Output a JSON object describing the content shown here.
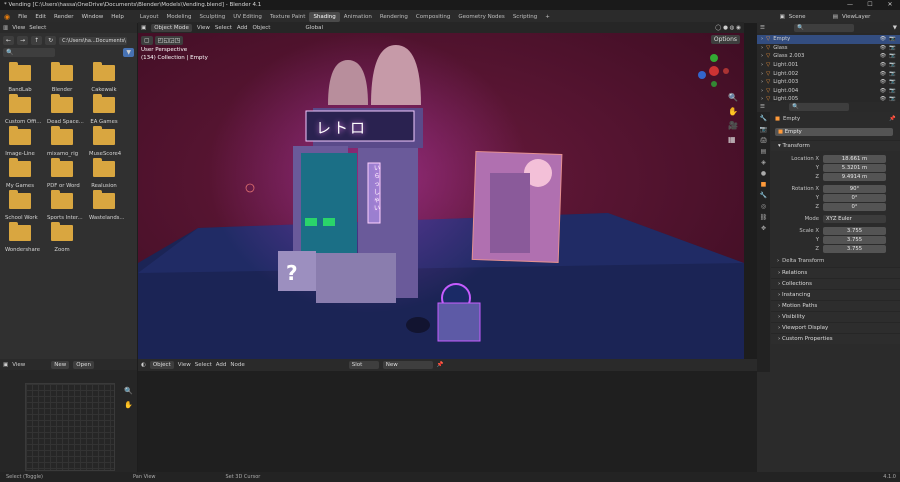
{
  "titlebar": {
    "title": "* Vending [C:\\Users\\hassa\\OneDrive\\Documents\\Blender\\Models\\Vending.blend] - Blender 4.1",
    "minimize": "—",
    "maximize": "☐",
    "close": "✕"
  },
  "menu": {
    "items": [
      "File",
      "Edit",
      "Render",
      "Window",
      "Help"
    ],
    "workspaces": [
      "Layout",
      "Modeling",
      "Sculpting",
      "UV Editing",
      "Texture Paint",
      "Shading",
      "Animation",
      "Rendering",
      "Compositing",
      "Geometry Nodes",
      "Scripting"
    ],
    "active_workspace": "Shading",
    "add_tab": "+",
    "scene_label": "Scene",
    "view_layer_label": "ViewLayer"
  },
  "filebrowser": {
    "view": "View",
    "select": "Select",
    "path": "C:\\Users\\ha...Documents\\",
    "folders": [
      "BandLab",
      "Blender",
      "Cakewalk",
      "Custom Offi...",
      "Dead Space...",
      "EA Games",
      "Image-Line",
      "mixamo_rig",
      "MuseScore4",
      "My Games",
      "PDF or Word",
      "Realusion",
      "School Work",
      "Sports Inter...",
      "Wastelands...",
      "Wondershare",
      "Zoom"
    ]
  },
  "viewport": {
    "mode": "Object Mode",
    "view": "View",
    "select": "Select",
    "add": "Add",
    "object": "Object",
    "orientation": "Global",
    "options": "Options",
    "overlay_title": "User Perspective",
    "overlay_sub": "(134) Collection | Empty",
    "sign": "レトロ",
    "sign_vertical": "いらっしゃい",
    "question": "?"
  },
  "outliner": {
    "rows": [
      {
        "name": "Empty",
        "selected": true
      },
      {
        "name": "Glass"
      },
      {
        "name": "Glass 2.003"
      },
      {
        "name": "Light.001"
      },
      {
        "name": "Light.002"
      },
      {
        "name": "Light.003"
      },
      {
        "name": "Light.004"
      },
      {
        "name": "Light.005"
      }
    ]
  },
  "properties": {
    "object_name": "Empty",
    "data_name": "Empty",
    "transform_title": "Transform",
    "location": {
      "label": "Location X",
      "x": "18.661 m",
      "y": "5.3201 m",
      "z": "9.4914 m"
    },
    "rotation": {
      "label": "Rotation X",
      "x": "90°",
      "y": "0°",
      "z": "0°"
    },
    "mode_label": "Mode",
    "mode_value": "XYZ Euler",
    "scale": {
      "label": "Scale X",
      "x": "3.755",
      "y": "3.755",
      "z": "3.755"
    },
    "y_label": "Y",
    "z_label": "Z",
    "delta": "Delta Transform",
    "sections": [
      "Relations",
      "Collections",
      "Instancing",
      "Motion Paths",
      "Visibility",
      "Viewport Display",
      "Custom Properties"
    ]
  },
  "image_editor": {
    "view": "View",
    "new": "New",
    "open": "Open"
  },
  "node_editor": {
    "object": "Object",
    "view": "View",
    "select": "Select",
    "add": "Add",
    "node": "Node",
    "slot": "Slot",
    "new": "New"
  },
  "statusbar": {
    "left": "Select (Toggle)",
    "mid": "Pan View",
    "right": "Set 3D Cursor",
    "version": "4.1.0"
  }
}
